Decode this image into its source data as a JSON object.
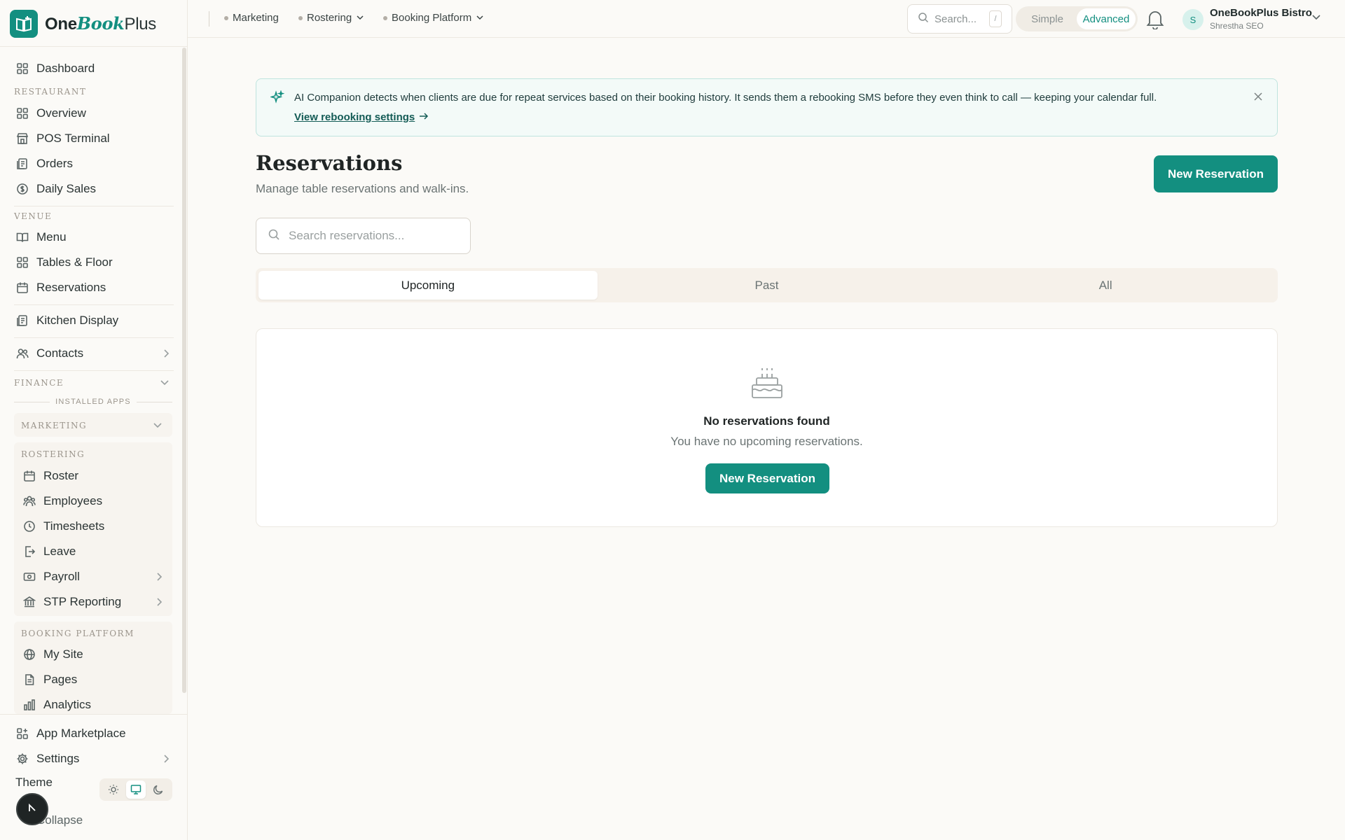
{
  "brand": {
    "part1": "One",
    "part2": "Book",
    "part3": "Plus"
  },
  "sidebar": {
    "dashboard": "Dashboard",
    "restaurant_label": "RESTAURANT",
    "restaurant_items": [
      "Overview",
      "POS Terminal",
      "Orders",
      "Daily Sales"
    ],
    "venue_label": "VENUE",
    "venue_items": [
      "Menu",
      "Tables & Floor",
      "Reservations"
    ],
    "kitchen": "Kitchen Display",
    "contacts": "Contacts",
    "finance_label": "FINANCE",
    "installed_label": "INSTALLED APPS",
    "marketing_label": "MARKETING",
    "rostering_label": "ROSTERING",
    "rostering_items": [
      "Roster",
      "Employees",
      "Timesheets",
      "Leave",
      "Payroll",
      "STP Reporting"
    ],
    "booking_label": "BOOKING PLATFORM",
    "booking_items": [
      "My Site",
      "Pages",
      "Analytics"
    ],
    "app_marketplace": "App Marketplace",
    "settings": "Settings",
    "theme": "Theme",
    "collapse": "Collapse"
  },
  "topbar": {
    "links": [
      "Marketing",
      "Rostering",
      "Booking Platform"
    ],
    "search_placeholder": "Search...",
    "search_kbd": "/",
    "mode_simple": "Simple",
    "mode_advanced": "Advanced",
    "user_initial": "S",
    "user_name": "OneBookPlus Bistro",
    "user_role": "Shrestha SEO"
  },
  "banner": {
    "text": "AI Companion detects when clients are due for repeat services based on their booking history. It sends them a rebooking SMS before they even think to call — keeping your calendar full.",
    "link": "View rebooking settings"
  },
  "page": {
    "title": "Reservations",
    "subtitle": "Manage table reservations and walk-ins.",
    "new_button": "New Reservation",
    "search_placeholder": "Search reservations...",
    "tabs": [
      "Upcoming",
      "Past",
      "All"
    ],
    "empty_title": "No reservations found",
    "empty_sub": "You have no upcoming reservations.",
    "empty_button": "New Reservation"
  },
  "colors": {
    "accent": "#138f80",
    "background": "#fbfaf7"
  }
}
